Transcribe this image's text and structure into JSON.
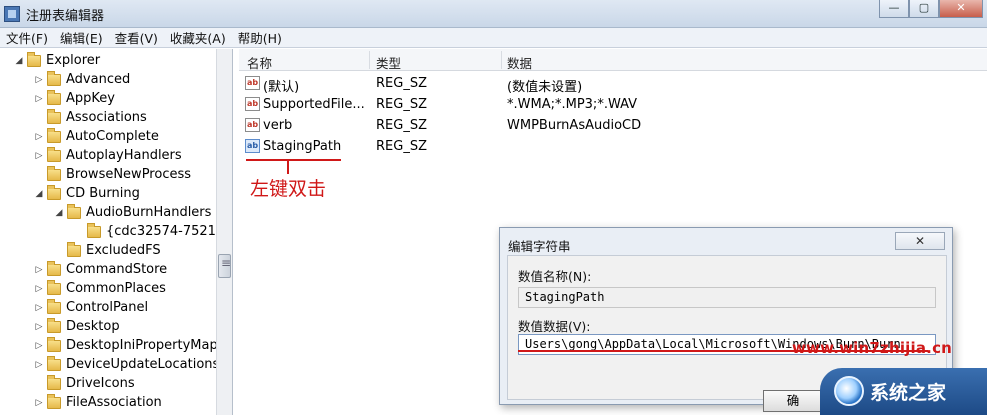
{
  "window": {
    "title": "注册表编辑器",
    "buttons": [
      "—",
      "▢",
      "✕"
    ]
  },
  "menu": [
    "文件(F)",
    "编辑(E)",
    "查看(V)",
    "收藏夹(A)",
    "帮助(H)"
  ],
  "tree": {
    "items": [
      {
        "label": "Explorer",
        "expander": "◢"
      },
      {
        "label": "Advanced",
        "expander": "▷"
      },
      {
        "label": "AppKey",
        "expander": "▷"
      },
      {
        "label": "Associations",
        "expander": ""
      },
      {
        "label": "AutoComplete",
        "expander": "▷"
      },
      {
        "label": "AutoplayHandlers",
        "expander": "▷"
      },
      {
        "label": "BrowseNewProcess",
        "expander": ""
      },
      {
        "label": "CD Burning",
        "expander": "◢"
      },
      {
        "label": "AudioBurnHandlers",
        "expander": "◢"
      },
      {
        "label": "{cdc32574-7521-",
        "expander": ""
      },
      {
        "label": "ExcludedFS",
        "expander": ""
      },
      {
        "label": "CommandStore",
        "expander": "▷"
      },
      {
        "label": "CommonPlaces",
        "expander": "▷"
      },
      {
        "label": "ControlPanel",
        "expander": "▷"
      },
      {
        "label": "Desktop",
        "expander": "▷"
      },
      {
        "label": "DesktopIniPropertyMap",
        "expander": "▷"
      },
      {
        "label": "DeviceUpdateLocations",
        "expander": "▷"
      },
      {
        "label": "DriveIcons",
        "expander": ""
      },
      {
        "label": "FileAssociation",
        "expander": "▷"
      }
    ]
  },
  "list": {
    "columns": [
      "名称",
      "类型",
      "数据"
    ],
    "rows": [
      {
        "name": "(默认)",
        "type": "REG_SZ",
        "data": "(数值未设置)"
      },
      {
        "name": "SupportedFile...",
        "type": "REG_SZ",
        "data": "*.WMA;*.MP3;*.WAV"
      },
      {
        "name": "verb",
        "type": "REG_SZ",
        "data": "WMPBurnAsAudioCD"
      },
      {
        "name": "StagingPath",
        "type": "REG_SZ",
        "data": ""
      }
    ],
    "icon_text": "ab"
  },
  "annotation": {
    "text": "左键双击",
    "color": "#d01818"
  },
  "dialog": {
    "title": "编辑字符串",
    "close": "✕",
    "name_label": "数值名称(N):",
    "name_value": "StagingPath",
    "data_label": "数值数据(V):",
    "data_value": "Users\\gong\\AppData\\Local\\Microsoft\\Windows\\Burn\\Burn",
    "ok_label": "确"
  },
  "watermark": {
    "url": "www.win7zhijia.cn",
    "logo_text": "系统之家"
  }
}
